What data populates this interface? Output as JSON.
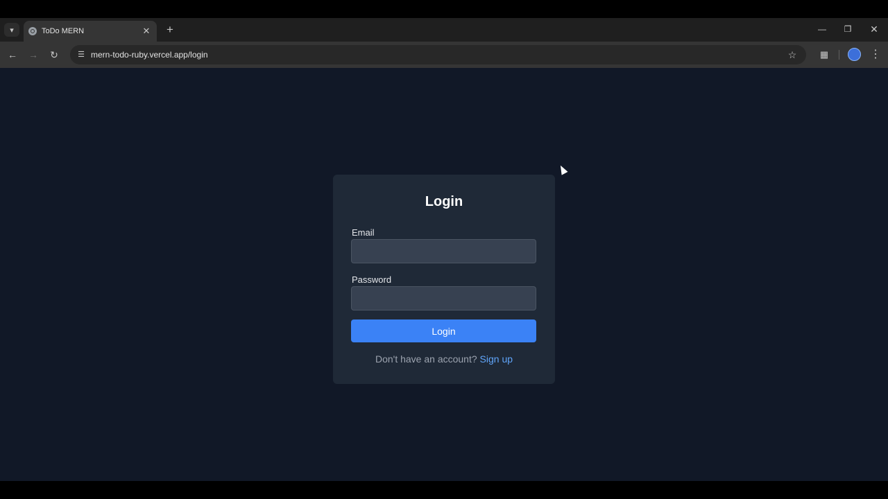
{
  "browser": {
    "tab": {
      "title": "ToDo MERN",
      "favicon": "globe-icon"
    },
    "address": {
      "url": "mern-todo-ruby.vercel.app/login"
    },
    "icons": {
      "tab_search": "chevron-down-icon",
      "tab_close": "close-icon",
      "new_tab": "plus-icon",
      "back": "arrow-left-icon",
      "forward": "arrow-right-icon",
      "reload": "reload-icon",
      "site_info": "tune-icon",
      "bookmark": "star-icon",
      "extensions": "puzzle-icon",
      "profile": "avatar",
      "menu": "more-vert-icon",
      "minimize": "minimize-icon",
      "restore": "restore-icon",
      "close_window": "close-icon"
    }
  },
  "login": {
    "title": "Login",
    "email_label": "Email",
    "email_value": "",
    "password_label": "Password",
    "password_value": "",
    "submit_label": "Login",
    "signup_prompt": "Don't have an account?",
    "signup_link": "Sign up"
  },
  "colors": {
    "page_bg": "#111827",
    "card_bg": "#1f2937",
    "input_bg": "#374151",
    "button_bg": "#3b82f6",
    "link": "#60a5fa"
  }
}
